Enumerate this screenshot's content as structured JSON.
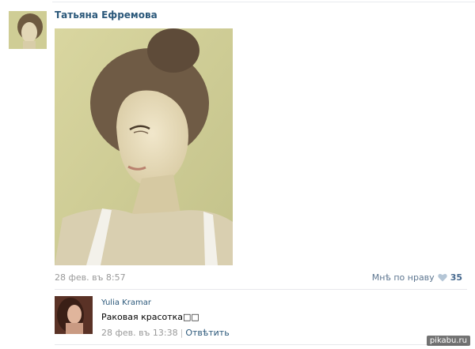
{
  "post": {
    "author": "Татьяна Ефремова",
    "date": "28 фев. въ 8:57",
    "like_label": "Мнѣ по нраву",
    "like_count": "35"
  },
  "comment": {
    "author": "Yulia Kramar",
    "text": "Раковая красотка",
    "date": "28 фев. въ 13:38",
    "reply_label": "Отвѣтить"
  },
  "watermark": "pikabu.ru",
  "colors": {
    "link": "#2b587a",
    "meta": "#999999",
    "like_heart": "#b5c6d6"
  }
}
